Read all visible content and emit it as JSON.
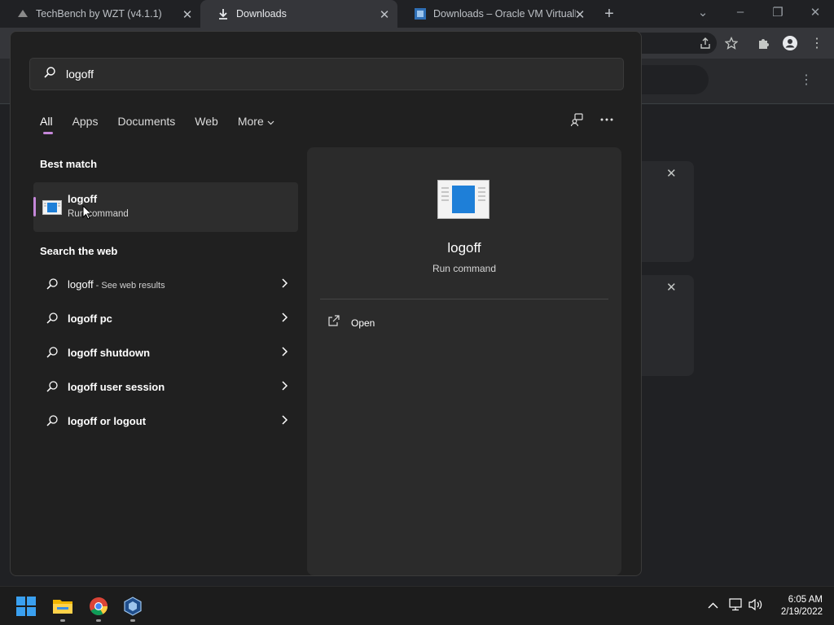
{
  "browser": {
    "tabs": [
      {
        "title": "TechBench by WZT (v4.1.1)",
        "icon": "techbench-favicon-icon"
      },
      {
        "title": "Downloads",
        "icon": "download-icon"
      },
      {
        "title": "Downloads – Oracle VM VirtualBox",
        "icon": "virtualbox-favicon-icon"
      }
    ],
    "tab_close": "✕",
    "new_tab": "+",
    "window_controls": {
      "tab_search": "⌄",
      "minimize": "–",
      "restore": "❐",
      "close": "✕"
    },
    "page_menu": "⋮",
    "card_close": "✕"
  },
  "search": {
    "query": "logoff",
    "filters": [
      "All",
      "Apps",
      "Documents",
      "Web",
      "More"
    ],
    "more_chevron": "⌄",
    "best_match": {
      "heading": "Best match",
      "name": "logoff",
      "type": "Run command"
    },
    "web": {
      "heading": "Search the web",
      "items": [
        {
          "text": "logoff",
          "suffix": " - See web results"
        },
        {
          "text": "logoff pc",
          "suffix": ""
        },
        {
          "text": "logoff shutdown",
          "suffix": ""
        },
        {
          "text": "logoff user session",
          "suffix": ""
        },
        {
          "text": "logoff or logout",
          "suffix": ""
        }
      ]
    },
    "preview": {
      "name": "logoff",
      "type": "Run command",
      "actions": [
        {
          "label": "Open",
          "icon": "open-external-icon"
        }
      ]
    }
  },
  "taskbar": {
    "apps": [
      "start-icon",
      "file-explorer-icon",
      "chrome-icon",
      "virtualbox-icon"
    ],
    "time": "6:05 AM",
    "date": "2/19/2022"
  },
  "colors": {
    "accent": "#c587d9",
    "flyout_bg": "#202020",
    "preview_bg": "#2b2b2b"
  }
}
